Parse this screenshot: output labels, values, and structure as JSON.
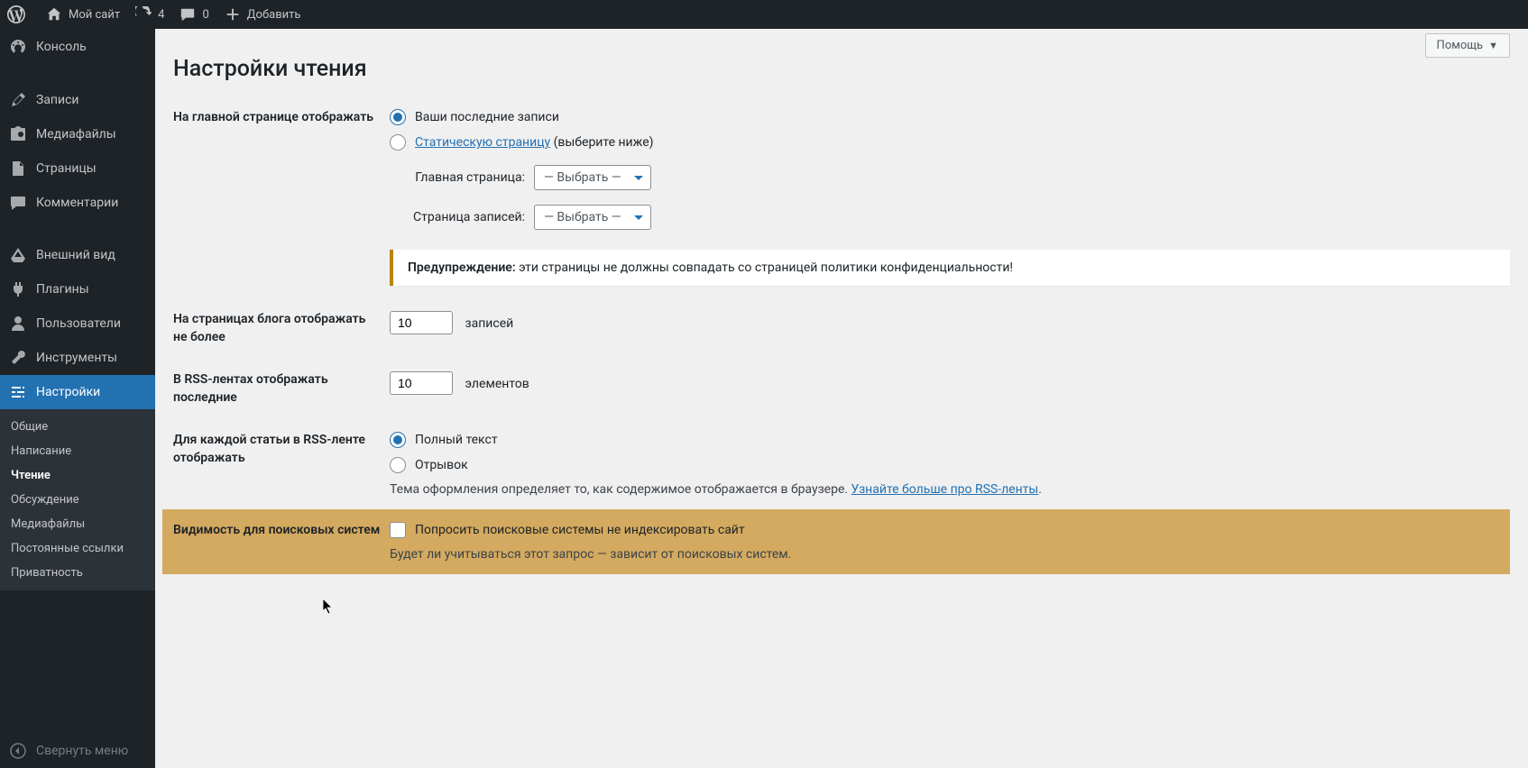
{
  "adminbar": {
    "site_name": "Мой сайт",
    "updates_count": "4",
    "comments_count": "0",
    "add_new": "Добавить"
  },
  "sidebar": {
    "dashboard": "Консоль",
    "posts": "Записи",
    "media": "Медиафайлы",
    "pages": "Страницы",
    "comments": "Комментарии",
    "appearance": "Внешний вид",
    "plugins": "Плагины",
    "users": "Пользователи",
    "tools": "Инструменты",
    "settings": "Настройки",
    "submenu": {
      "general": "Общие",
      "writing": "Написание",
      "reading": "Чтение",
      "discussion": "Обсуждение",
      "media": "Медиафайлы",
      "permalinks": "Постоянные ссылки",
      "privacy": "Приватность"
    },
    "collapse": "Свернуть меню"
  },
  "content": {
    "help": "Помощь",
    "page_title": "Настройки чтения",
    "front_page": {
      "label": "На главной странице отображать",
      "opt_latest": "Ваши последние записи",
      "opt_static_link": "Статическую страницу",
      "opt_static_suffix": " (выберите ниже)",
      "home_label": "Главная страница:",
      "posts_label": "Страница записей:",
      "select_placeholder": "— Выбрать —"
    },
    "warning": {
      "prefix": "Предупреждение:",
      "text": " эти страницы не должны совпадать со страницей политики конфиденциальности!"
    },
    "blog_pages": {
      "label": "На страницах блога отображать не более",
      "value": "10",
      "suffix": "записей"
    },
    "rss_items": {
      "label": "В RSS-лентах отображать последние",
      "value": "10",
      "suffix": "элементов"
    },
    "rss_content": {
      "label": "Для каждой статьи в RSS-ленте отображать",
      "opt_full": "Полный текст",
      "opt_excerpt": "Отрывок",
      "desc_prefix": "Тема оформления определяет то, как содержимое отображается в браузере. ",
      "desc_link": "Узнайте больше про RSS-ленты",
      "desc_suffix": "."
    },
    "visibility": {
      "label": "Видимость для поисковых систем",
      "checkbox": "Попросить поисковые системы не индексировать сайт",
      "desc": "Будет ли учитываться этот запрос — зависит от поисковых систем."
    }
  }
}
